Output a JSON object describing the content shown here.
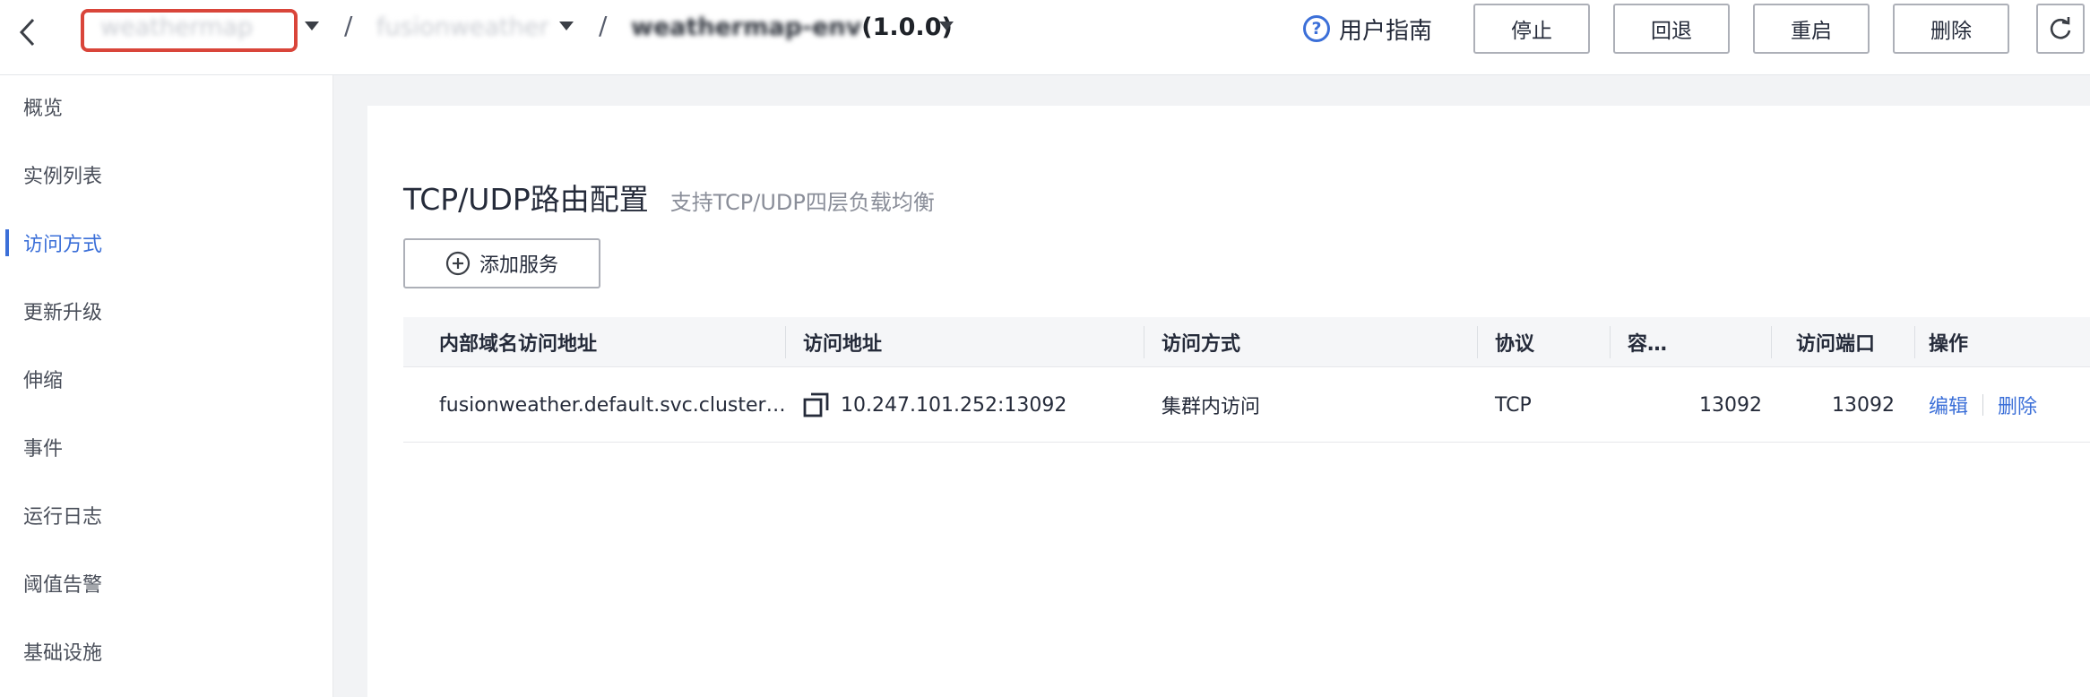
{
  "header": {
    "crumbs": {
      "app": "weathermap",
      "service": "fusionweather",
      "release_blur": "weathermap-env",
      "release_version": "(1.0.0)"
    },
    "slash": "/",
    "guide_label": "用户指南",
    "buttons": {
      "stop": "停止",
      "rollback": "回退",
      "restart": "重启",
      "delete": "删除"
    }
  },
  "sidebar": {
    "items": [
      {
        "label": "概览"
      },
      {
        "label": "实例列表"
      },
      {
        "label": "访问方式"
      },
      {
        "label": "更新升级"
      },
      {
        "label": "伸缩"
      },
      {
        "label": "事件"
      },
      {
        "label": "运行日志"
      },
      {
        "label": "阈值告警"
      },
      {
        "label": "基础设施"
      }
    ],
    "active": "访问方式"
  },
  "main": {
    "title": "TCP/UDP路由配置",
    "subtitle": "支持TCP/UDP四层负载均衡",
    "add_button": "添加服务",
    "table": {
      "columns": [
        "内部域名访问地址",
        "访问地址",
        "访问方式",
        "协议",
        "容…",
        "访问端口",
        "操作"
      ],
      "rows": [
        {
          "internal_domain": "fusionweather.default.svc.cluster…",
          "address": "10.247.101.252:13092",
          "access_mode": "集群内访问",
          "protocol": "TCP",
          "container_port": "13092",
          "access_port": "13092",
          "actions": {
            "edit": "编辑",
            "delete": "删除"
          }
        }
      ]
    }
  },
  "colors": {
    "accent": "#3b6fd8",
    "highlight_box": "#d9453a"
  }
}
